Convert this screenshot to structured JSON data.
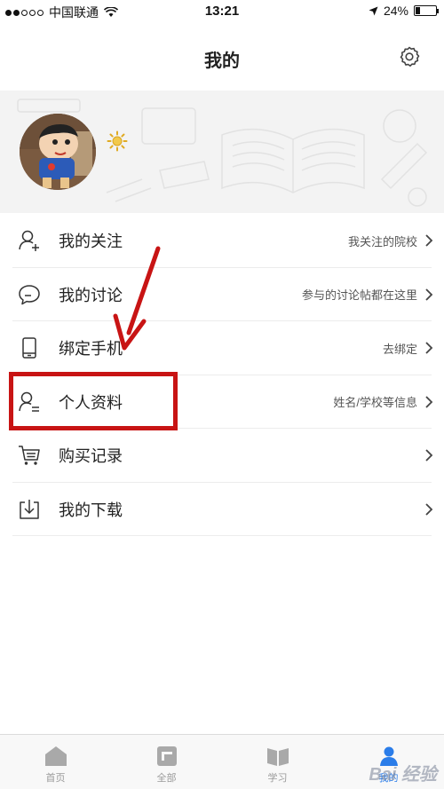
{
  "status_bar": {
    "carrier": "中国联通",
    "time": "13:21",
    "battery_text": "24%",
    "battery_level": 0.24
  },
  "nav": {
    "title": "我的"
  },
  "menu": {
    "items": [
      {
        "label": "我的关注",
        "hint": "我关注的院校",
        "icon": "follow-user-icon"
      },
      {
        "label": "我的讨论",
        "hint": "参与的讨论帖都在这里",
        "icon": "chat-bubble-icon"
      },
      {
        "label": "绑定手机",
        "hint": "去绑定",
        "icon": "phone-icon"
      },
      {
        "label": "个人资料",
        "hint": "姓名/学校等信息",
        "icon": "profile-icon"
      },
      {
        "label": "购买记录",
        "hint": "",
        "icon": "cart-icon"
      },
      {
        "label": "我的下载",
        "hint": "",
        "icon": "download-icon"
      }
    ]
  },
  "tabs": [
    {
      "label": "首页",
      "icon": "home-icon",
      "active": false
    },
    {
      "label": "全部",
      "icon": "category-icon",
      "active": false
    },
    {
      "label": "学习",
      "icon": "book-icon",
      "active": false
    },
    {
      "label": "我的",
      "icon": "user-icon",
      "active": true
    }
  ],
  "colors": {
    "accent": "#2b7de9",
    "annotation": "#c81414"
  },
  "watermark": "Bai 经验"
}
